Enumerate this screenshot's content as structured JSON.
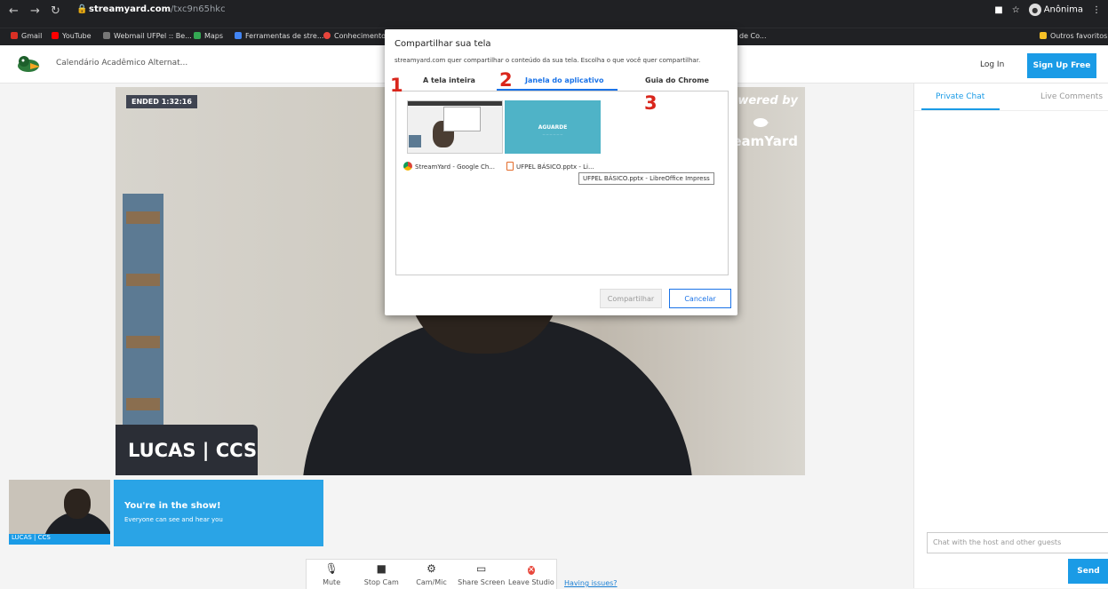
{
  "browser": {
    "url_host": "streamyard.com",
    "url_path": "/txc9n65hkc",
    "profile": "Anônima",
    "bookmarks": [
      "Gmail",
      "YouTube",
      "Webmail UFPel :: Be...",
      "Maps",
      "Ferramentas de stre...",
      "Conhecimentos",
      "de Co...",
      "Outros favoritos"
    ]
  },
  "header": {
    "studio_title": "Calendário Acadêmico Alternat...",
    "login": "Log In",
    "signup": "Sign Up Free"
  },
  "stage": {
    "ended_badge": "ENDED 1:32:16",
    "powered_by": "owered by",
    "brand": "eamYard",
    "name_plate": "LUCAS | CCS"
  },
  "participants": {
    "thumb_label": "LUCAS | CCS",
    "in_show_title": "You're in the show!",
    "in_show_sub": "Everyone can see and hear you"
  },
  "controls": {
    "mute": "Mute",
    "stop_cam": "Stop Cam",
    "cam_mic": "Cam/Mic",
    "share_screen": "Share Screen",
    "leave": "Leave Studio",
    "issues": "Having issues?"
  },
  "chat": {
    "tab_private": "Private Chat",
    "tab_live": "Live Comments",
    "placeholder": "Chat with the host and other guests",
    "send": "Send"
  },
  "dialog": {
    "title": "Compartilhar sua tela",
    "subtitle": "streamyard.com quer compartilhar o conteúdo da sua tela. Escolha o que você quer compartilhar.",
    "tabs": [
      "A tela inteira",
      "Janela do aplicativo",
      "Guia do Chrome"
    ],
    "windows": [
      {
        "label": "StreamYard - Google Ch..."
      },
      {
        "label": "UFPEL BÁSICO.pptx - Li...",
        "thumb_text": "AGUARDE"
      }
    ],
    "tooltip": "UFPEL BÁSICO.pptx - LibreOffice Impress",
    "share": "Compartilhar",
    "cancel": "Cancelar"
  },
  "markers": [
    "1",
    "2",
    "3"
  ],
  "colors": {
    "accent": "#1a9be6",
    "dialog_accent": "#1a73e8",
    "marker": "#d9261c",
    "leave": "#e8473c"
  }
}
